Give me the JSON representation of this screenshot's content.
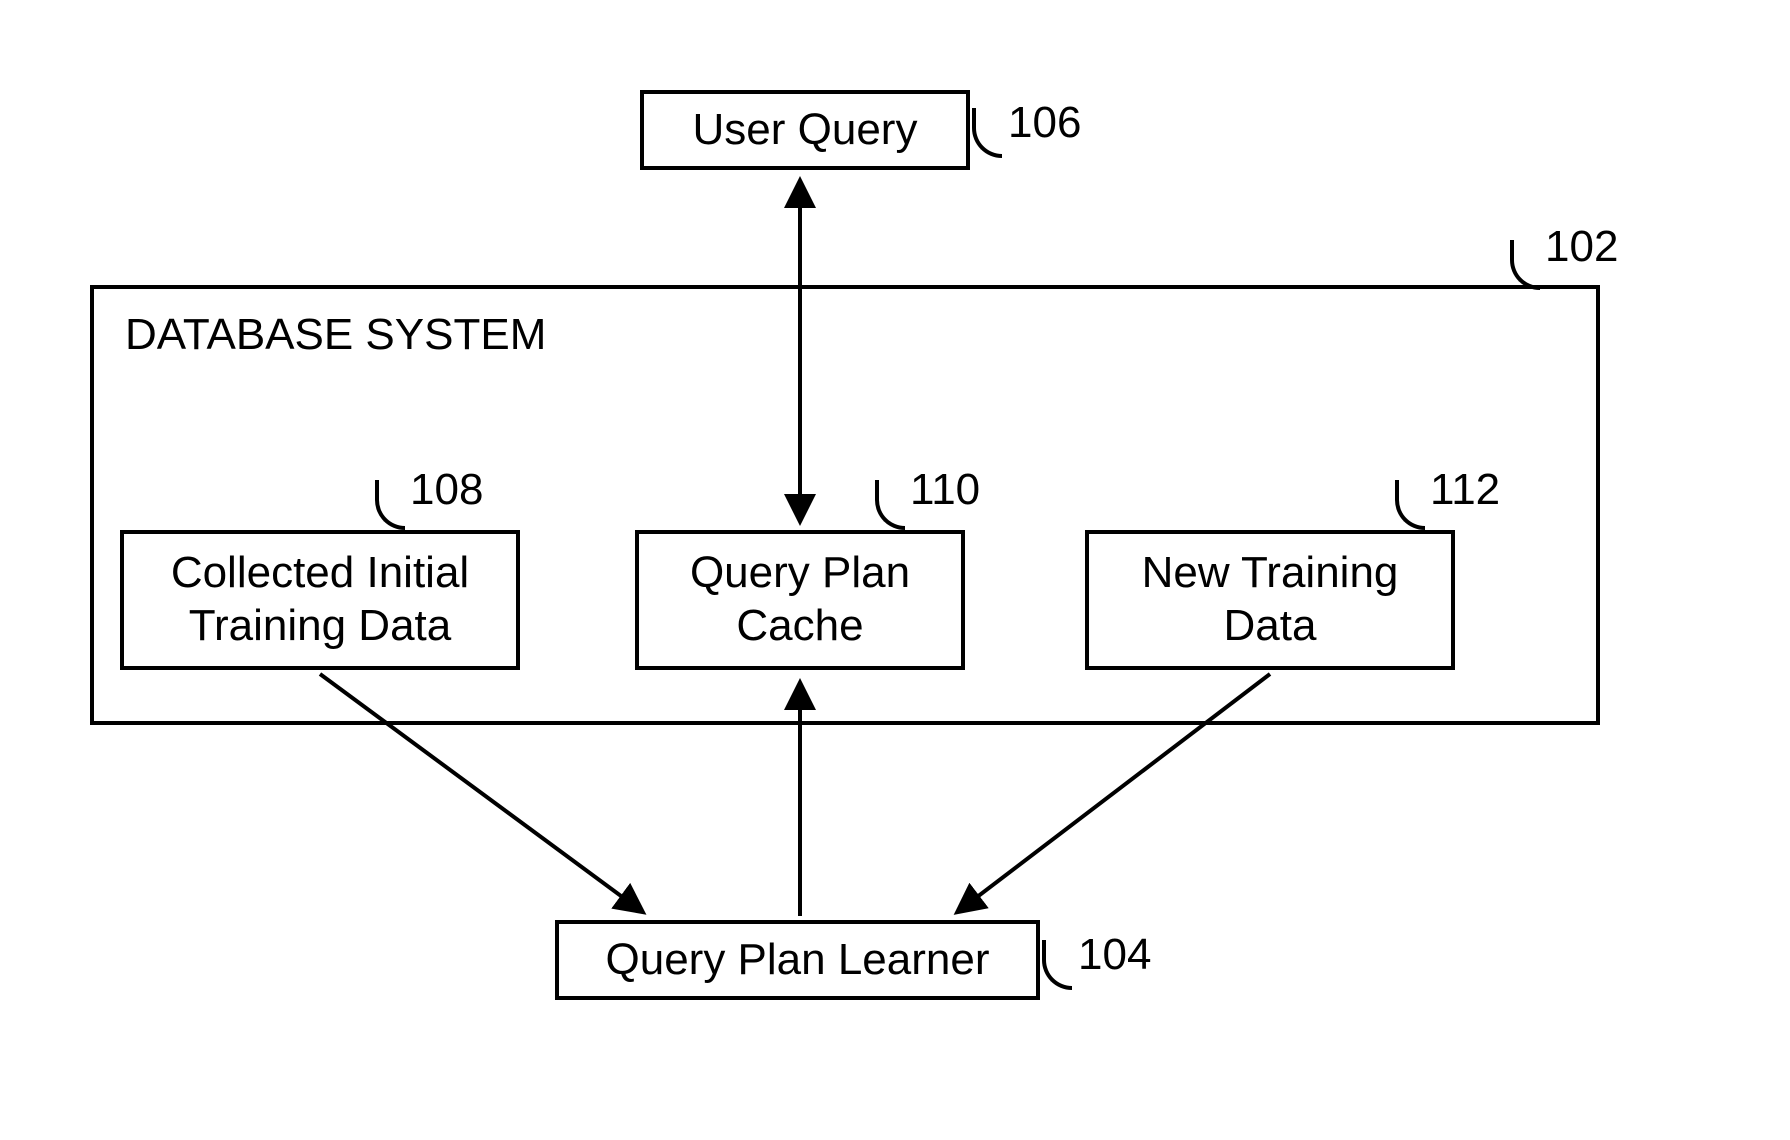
{
  "boxes": {
    "user_query": {
      "label": "User Query",
      "ref": "106"
    },
    "database_system": {
      "label": "DATABASE SYSTEM",
      "ref": "102"
    },
    "collected_initial": {
      "label": "Collected Initial\nTraining Data",
      "ref": "108"
    },
    "query_plan_cache": {
      "label": "Query Plan\nCache",
      "ref": "110"
    },
    "new_training": {
      "label": "New Training\nData",
      "ref": "112"
    },
    "query_plan_learner": {
      "label": "Query Plan Learner",
      "ref": "104"
    }
  }
}
